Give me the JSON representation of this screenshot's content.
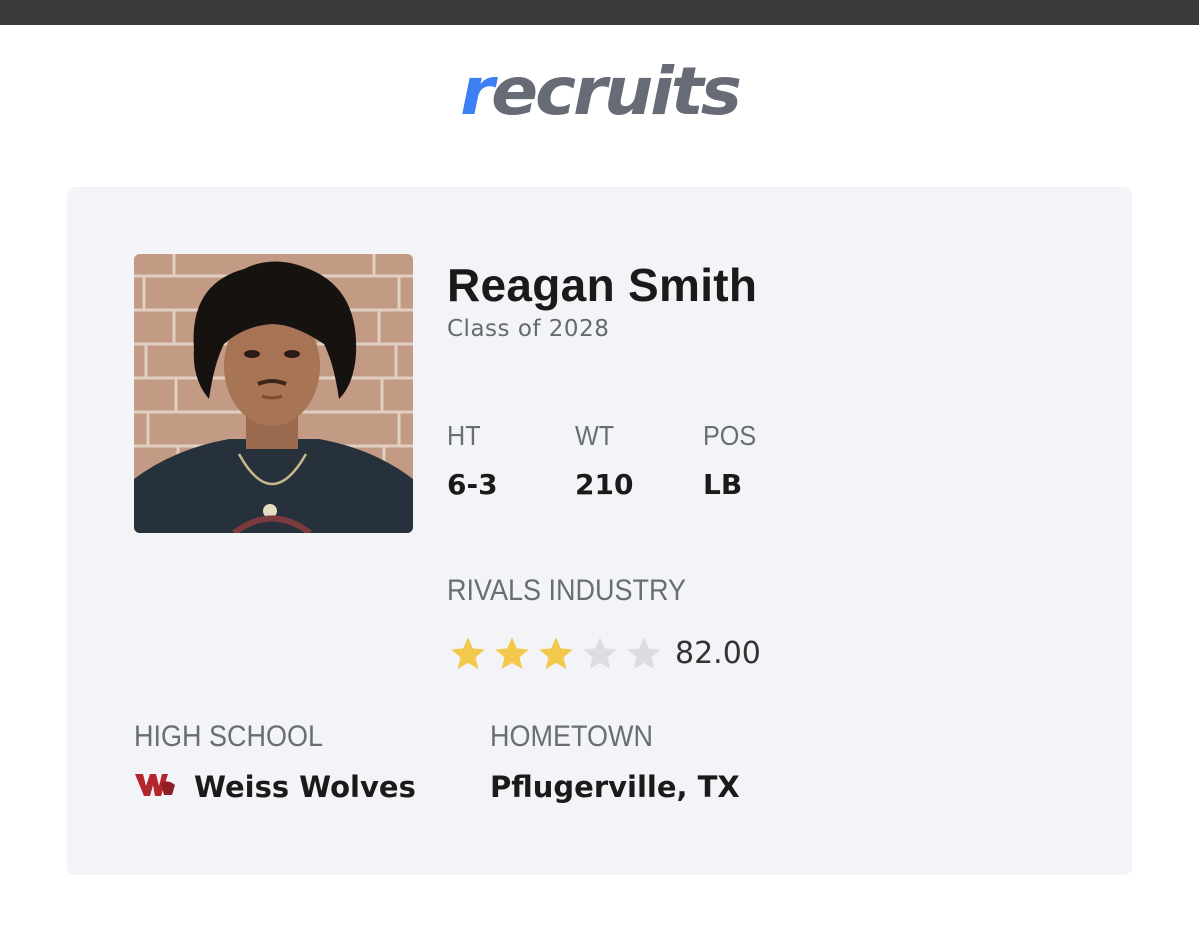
{
  "brand": {
    "logo_first": "r",
    "logo_rest": "ecruits",
    "accent_color": "#3d7ff5",
    "logo_text_color": "#676b76"
  },
  "player": {
    "name": "Reagan Smith",
    "class": "Class of 2028",
    "photo_icon": "player-headshot",
    "stats": {
      "ht_label": "HT",
      "ht_value": "6-3",
      "wt_label": "WT",
      "wt_value": "210",
      "pos_label": "POS",
      "pos_value": "LB"
    },
    "rating": {
      "label": "RIVALS INDUSTRY",
      "stars_filled": 3,
      "stars_total": 5,
      "score": "82.00",
      "star_color": "#f2c94c",
      "empty_star_color": "#dcdde1"
    },
    "high_school": {
      "label": "HIGH SCHOOL",
      "name": "Weiss Wolves",
      "logo_icon": "weiss-wolves-logo",
      "logo_color": "#b3262b"
    },
    "hometown": {
      "label": "HOMETOWN",
      "value": "Pflugerville, TX"
    }
  }
}
